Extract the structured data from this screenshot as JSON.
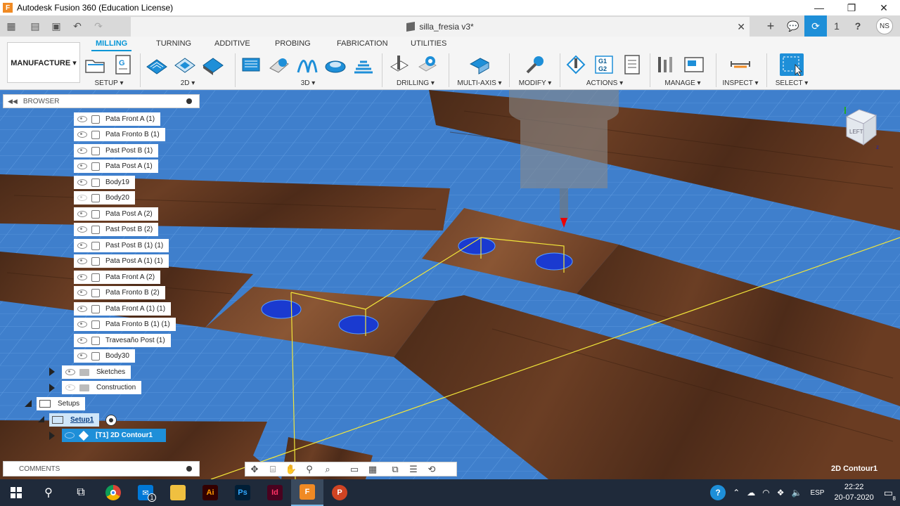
{
  "window": {
    "app_icon": "F",
    "title": "Autodesk Fusion 360 (Education License)",
    "minimize": "—",
    "maximize": "❐",
    "close": "✕"
  },
  "document": {
    "name": "silla_fresia v3*",
    "close": "✕"
  },
  "quick_access": {
    "grid_icon": "▦",
    "file_icon": "▤",
    "save_icon": "▣",
    "undo_icon": "↶",
    "redo_icon": "↷"
  },
  "account": {
    "add_tab": "+",
    "jobs_count": "1",
    "help": "?",
    "user_initials": "NS"
  },
  "ribbon": {
    "workspace": "MANUFACTURE ▾",
    "tabs": [
      "MILLING",
      "TURNING",
      "ADDITIVE",
      "PROBING",
      "FABRICATION",
      "UTILITIES"
    ],
    "groups": {
      "setup": "SETUP ▾",
      "two_d": "2D ▾",
      "three_d": "3D ▾",
      "drilling": "DRILLING ▾",
      "multi_axis": "MULTI-AXIS ▾",
      "modify": "MODIFY ▾",
      "actions": "ACTIONS ▾",
      "manage": "MANAGE ▾",
      "inspect": "INSPECT ▾",
      "select": "SELECT ▾"
    },
    "g1g2_label": "G1 G2"
  },
  "browser": {
    "title": "BROWSER",
    "collapse": "◀◀",
    "bodies": [
      {
        "label": "Pata Front A (1)",
        "visible": true
      },
      {
        "label": "Pata Fronto B (1)",
        "visible": true
      },
      {
        "label": "Past Post B (1)",
        "visible": true
      },
      {
        "label": "Pata Post A (1)",
        "visible": true
      },
      {
        "label": "Body19",
        "visible": true
      },
      {
        "label": "Body20",
        "visible": false
      },
      {
        "label": "Pata Post A (2)",
        "visible": true
      },
      {
        "label": "Past Post B (2)",
        "visible": true
      },
      {
        "label": "Past Post B (1) (1)",
        "visible": true
      },
      {
        "label": "Pata Post A (1) (1)",
        "visible": true
      },
      {
        "label": "Pata Front A (2)",
        "visible": true
      },
      {
        "label": "Pata Fronto B (2)",
        "visible": true
      },
      {
        "label": "Pata Front A (1) (1)",
        "visible": true
      },
      {
        "label": "Pata Fronto B (1) (1)",
        "visible": true
      },
      {
        "label": "Travesaño Post (1)",
        "visible": true
      },
      {
        "label": "Body30",
        "visible": true
      }
    ],
    "sketches": "Sketches",
    "construction": "Construction",
    "setups": "Setups",
    "setup1": "Setup1",
    "operation": "[T1] 2D Contour1"
  },
  "comments": {
    "title": "COMMENTS"
  },
  "status": {
    "selection": "2D Contour1"
  },
  "viewcube": {
    "face": "LEFT"
  },
  "taskbar": {
    "mail_badge": "1",
    "apps": [
      "Ai",
      "Ps",
      "Id",
      "F",
      "P"
    ],
    "language": "ESP",
    "time": "22:22",
    "date": "20-07-2020",
    "notifications": "8"
  },
  "colors": {
    "accent": "#0696d7",
    "selected_row": "#1e8fd8",
    "viewport_bg": "#3f7fcc",
    "wood": "#5a3320",
    "toolpath": "#f2e63a"
  }
}
